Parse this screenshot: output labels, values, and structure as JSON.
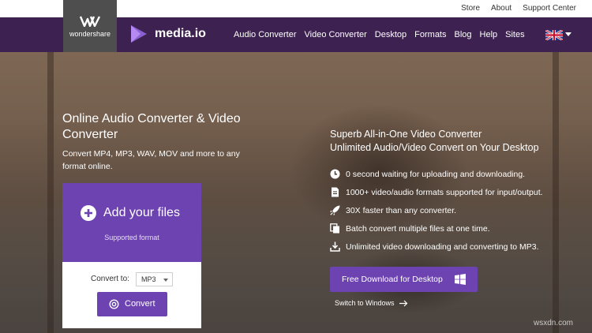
{
  "top_links": {
    "store": "Store",
    "about": "About",
    "support": "Support Center"
  },
  "brand": {
    "wondershare": "wondershare",
    "product": "media.io"
  },
  "nav": {
    "items": [
      "Audio Converter",
      "Video Converter",
      "Desktop",
      "Formats",
      "Blog",
      "Help",
      "Sites"
    ],
    "language_icon": "uk-flag-icon"
  },
  "hero": {
    "title": "Online Audio Converter & Video Converter",
    "subtitle": "Convert MP4, MP3, WAV, MOV and more to any format online."
  },
  "upload": {
    "add_label": "Add your files",
    "supported": "Supported format",
    "icon": "plus-circle-icon"
  },
  "convert": {
    "to_label": "Convert to:",
    "format_value": "MP3",
    "button_label": "Convert",
    "button_icon": "convert-icon"
  },
  "desktop": {
    "heading_line1": "Superb All-in-One Video Converter",
    "heading_line2": "Unlimited Audio/Video Convert on Your Desktop",
    "features": [
      {
        "icon": "clock-icon",
        "text": "0 second waiting for uploading and downloading."
      },
      {
        "icon": "file-icon",
        "text": "1000+ video/audio formats supported for input/output."
      },
      {
        "icon": "rocket-icon",
        "text": "30X faster than any converter."
      },
      {
        "icon": "copy-icon",
        "text": "Batch convert multiple files at one time."
      },
      {
        "icon": "download-icon",
        "text": "Unlimited video downloading and converting to MP3."
      }
    ],
    "download_label": "Free Download for Desktop",
    "download_icon": "windows-icon",
    "switch_label": "Switch to Windows",
    "switch_icon": "arrow-right-icon"
  },
  "watermark": "wsxdn.com",
  "colors": {
    "nav_bg": "#3d2150",
    "accent": "#6c43b0",
    "brand_box": "#4e4e4e"
  }
}
